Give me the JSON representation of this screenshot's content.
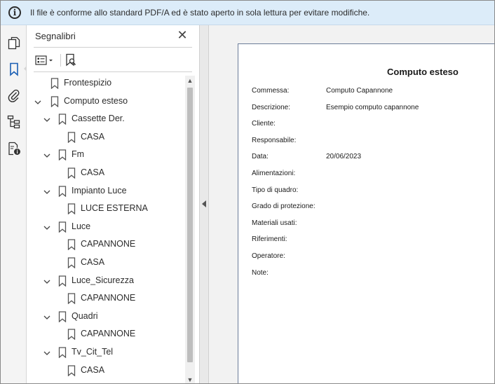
{
  "infobar": {
    "icon": "info-icon",
    "message": "Il file è conforme allo standard PDF/A ed è stato aperto in sola lettura per evitare modifiche."
  },
  "rail": {
    "items": [
      {
        "icon": "pages-icon"
      },
      {
        "icon": "bookmark-icon",
        "active": true
      },
      {
        "icon": "attachment-icon"
      },
      {
        "icon": "layers-icon"
      },
      {
        "icon": "document-lock-icon"
      }
    ]
  },
  "bookmarks_panel": {
    "title": "Segnalibri",
    "close_icon": "close-icon",
    "toolbar": {
      "options_icon": "list-options-icon",
      "find_icon": "find-bookmark-icon"
    },
    "items": [
      {
        "label": "Frontespizio",
        "level": 0,
        "expanded": null
      },
      {
        "label": "Computo esteso",
        "level": 0,
        "expanded": true
      },
      {
        "label": "Cassette Der.",
        "level": 1,
        "expanded": true
      },
      {
        "label": "CASA",
        "level": 2,
        "expanded": null
      },
      {
        "label": "Fm",
        "level": 1,
        "expanded": true
      },
      {
        "label": "CASA",
        "level": 2,
        "expanded": null
      },
      {
        "label": "Impianto Luce",
        "level": 1,
        "expanded": true
      },
      {
        "label": "LUCE ESTERNA",
        "level": 2,
        "expanded": null
      },
      {
        "label": "Luce",
        "level": 1,
        "expanded": true
      },
      {
        "label": "CAPANNONE",
        "level": 2,
        "expanded": null
      },
      {
        "label": "CASA",
        "level": 2,
        "expanded": null
      },
      {
        "label": "Luce_Sicurezza",
        "level": 1,
        "expanded": true
      },
      {
        "label": "CAPANNONE",
        "level": 2,
        "expanded": null
      },
      {
        "label": "Quadri",
        "level": 1,
        "expanded": true
      },
      {
        "label": "CAPANNONE",
        "level": 2,
        "expanded": null
      },
      {
        "label": "Tv_Cit_Tel",
        "level": 1,
        "expanded": true
      },
      {
        "label": "CASA",
        "level": 2,
        "expanded": null
      }
    ]
  },
  "document": {
    "title": "Computo esteso",
    "fields": [
      {
        "label": "Commessa:",
        "value": "Computo Capannone"
      },
      {
        "label": "Descrizione:",
        "value": "Esempio computo capannone"
      },
      {
        "label": "Cliente:",
        "value": ""
      },
      {
        "label": "Responsabile:",
        "value": ""
      },
      {
        "label": "Data:",
        "value": "20/06/2023"
      },
      {
        "label": "Alimentazioni:",
        "value": ""
      },
      {
        "label": "Tipo di quadro:",
        "value": ""
      },
      {
        "label": "Grado di protezione:",
        "value": ""
      },
      {
        "label": "Materiali usati:",
        "value": ""
      },
      {
        "label": "Riferimenti:",
        "value": ""
      },
      {
        "label": "Operatore:",
        "value": ""
      },
      {
        "label": "Note:",
        "value": ""
      }
    ]
  },
  "colors": {
    "infobar_bg": "#dcecf9",
    "accent": "#1a5fb4"
  }
}
